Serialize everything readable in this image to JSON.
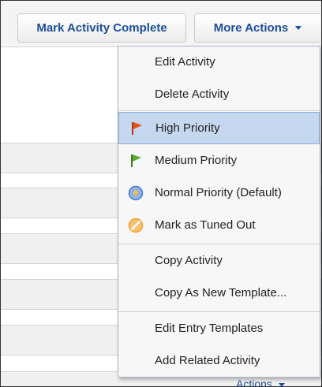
{
  "toolbar": {
    "mark_complete_label": "Mark Activity Complete",
    "more_actions_label": "More Actions"
  },
  "menu": {
    "items": [
      {
        "label": "Edit Activity",
        "icon": ""
      },
      {
        "label": "Delete Activity",
        "icon": ""
      },
      {
        "label": "High Priority",
        "icon": "red-flag-icon",
        "highlighted": true
      },
      {
        "label": "Medium Priority",
        "icon": "green-flag-icon"
      },
      {
        "label": "Normal Priority (Default)",
        "icon": "blue-lightning-icon"
      },
      {
        "label": "Mark as Tuned Out",
        "icon": "orange-no-icon"
      },
      {
        "label": "Copy Activity",
        "icon": ""
      },
      {
        "label": "Copy As New Template...",
        "icon": ""
      },
      {
        "label": "Edit Entry Templates",
        "icon": ""
      },
      {
        "label": "Add Related Activity",
        "icon": ""
      }
    ]
  },
  "background": {
    "actions_label": "Actions"
  },
  "colors": {
    "link_blue": "#1e4f9a",
    "highlight": "#c5d8ef",
    "high_priority": "#e8501c",
    "medium_priority": "#5aaa32",
    "normal_priority": "#4a78d0",
    "tuned_out": "#f0a030"
  }
}
